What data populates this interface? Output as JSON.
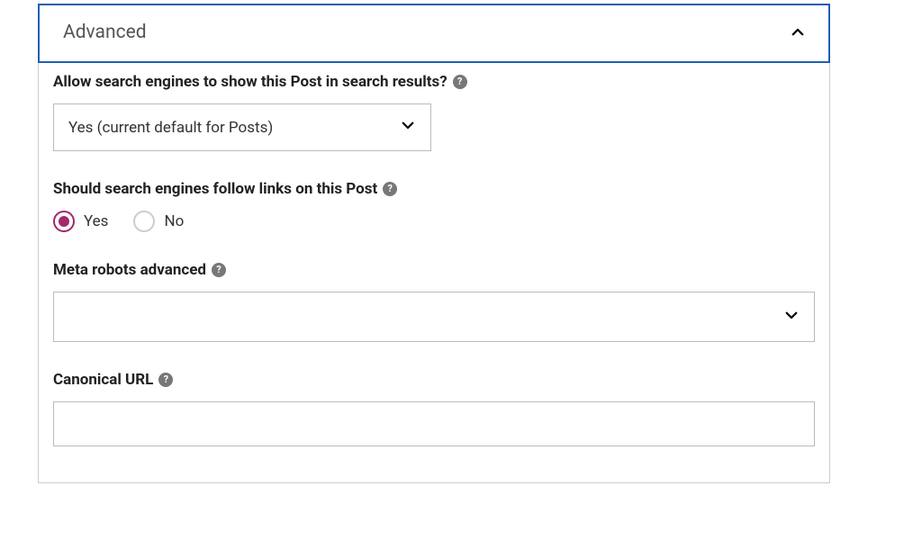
{
  "accordion": {
    "title": "Advanced"
  },
  "fields": {
    "allowSearch": {
      "label": "Allow search engines to show this Post in search results?",
      "selected": "Yes (current default for Posts)"
    },
    "followLinks": {
      "label": "Should search engines follow links on this Post",
      "options": {
        "yes": "Yes",
        "no": "No"
      },
      "value": "yes"
    },
    "metaRobots": {
      "label": "Meta robots advanced",
      "selected": ""
    },
    "canonical": {
      "label": "Canonical URL",
      "value": ""
    }
  },
  "colors": {
    "accent": "#a4286a",
    "focusBorder": "#1e5fb3"
  }
}
